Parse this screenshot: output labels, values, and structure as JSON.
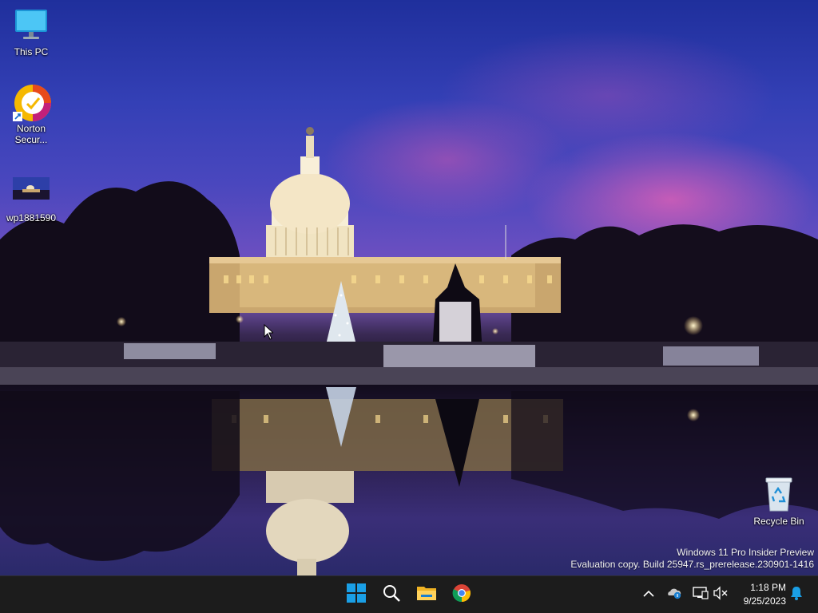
{
  "desktop": {
    "icons": [
      {
        "id": "this-pc",
        "label": "This PC",
        "icon": "monitor-icon"
      },
      {
        "id": "norton",
        "label": "Norton Secur...",
        "icon": "norton-icon"
      },
      {
        "id": "wp",
        "label": "wp1881590",
        "icon": "image-file-icon"
      },
      {
        "id": "recycle",
        "label": "Recycle Bin",
        "icon": "recycle-bin-icon"
      }
    ]
  },
  "watermark": {
    "line1": "Windows 11 Pro Insider Preview",
    "line2": "Evaluation copy. Build 25947.rs_prerelease.230901-1416"
  },
  "taskbar": {
    "apps": [
      {
        "id": "start",
        "icon": "windows-start-icon"
      },
      {
        "id": "search",
        "icon": "search-icon"
      },
      {
        "id": "explorer",
        "icon": "folder-icon"
      },
      {
        "id": "chrome",
        "icon": "chrome-icon"
      }
    ],
    "tray": {
      "time": "1:18 PM",
      "date": "9/25/2023",
      "icons": [
        "chevron-up-icon",
        "onedrive-icon",
        "network-icon",
        "volume-muted-icon",
        "bell-icon"
      ]
    },
    "colors": {
      "background": "#1c1c1c",
      "windows_blue": "#1a9fe6"
    }
  }
}
